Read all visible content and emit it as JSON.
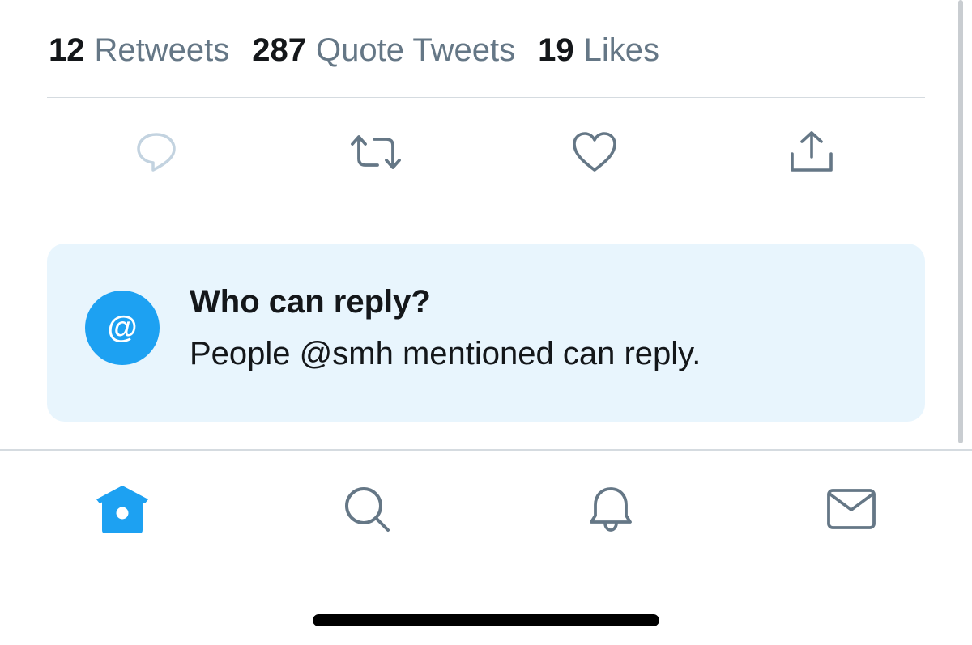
{
  "stats": {
    "retweets": {
      "count": "12",
      "label": "Retweets"
    },
    "quote_tweets": {
      "count": "287",
      "label": "Quote Tweets"
    },
    "likes": {
      "count": "19",
      "label": "Likes"
    }
  },
  "actions": {
    "reply": {
      "icon": "reply-icon",
      "disabled": true
    },
    "retweet": {
      "icon": "retweet-icon"
    },
    "like": {
      "icon": "heart-icon"
    },
    "share": {
      "icon": "share-icon"
    }
  },
  "reply_settings": {
    "icon_glyph": "@",
    "title": "Who can reply?",
    "description": "People @smh mentioned can reply."
  },
  "bottom_nav": {
    "items": [
      {
        "icon": "home-icon",
        "active": true
      },
      {
        "icon": "search-icon",
        "active": false
      },
      {
        "icon": "notifications-icon",
        "active": false
      },
      {
        "icon": "messages-icon",
        "active": false
      }
    ]
  },
  "colors": {
    "accent": "#1da1f2",
    "icon_gray": "#657786",
    "icon_disabled": "#c3d3e0",
    "card_bg": "#e8f5fd",
    "text": "#14171a"
  }
}
